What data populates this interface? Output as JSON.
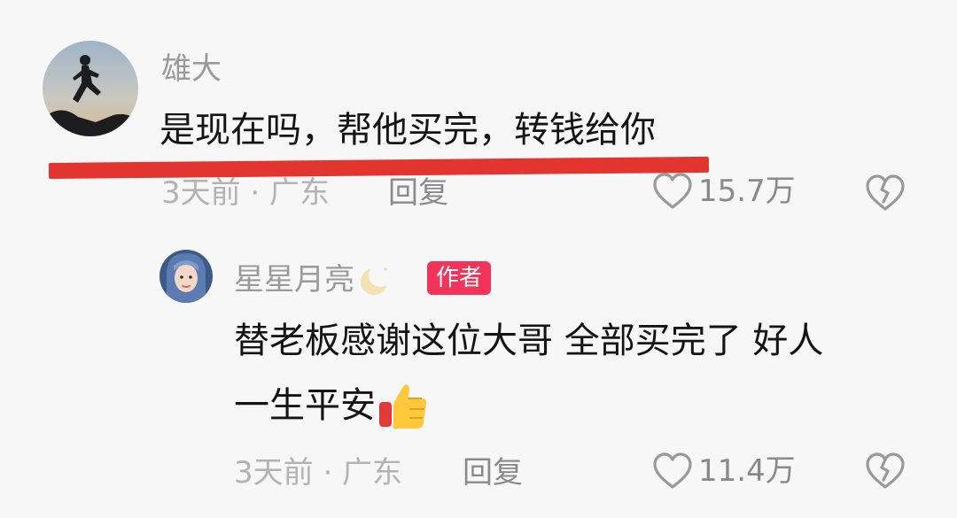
{
  "comments": [
    {
      "username": "雄大",
      "text": "是现在吗，帮他买完，转钱给你",
      "meta": "3天前 · 广东",
      "reply_label": "回复",
      "like_count": "15.7万",
      "avatar_icon": "runner-silhouette-avatar"
    }
  ],
  "reply": {
    "username": "星星月亮",
    "name_emoji": "crescent-moon-icon",
    "badge": "作者",
    "text_line1": "替老板感谢这位大哥  全部买完了  好人",
    "text_line2": "一生平安",
    "text_emoji": "thumbs-up-icon",
    "meta": "3天前 · 广东",
    "reply_label": "回复",
    "like_count": "11.4万"
  },
  "colors": {
    "background": "#f7f7f7",
    "highlight_underline": "#e2352f",
    "author_badge": "#f2335a"
  }
}
